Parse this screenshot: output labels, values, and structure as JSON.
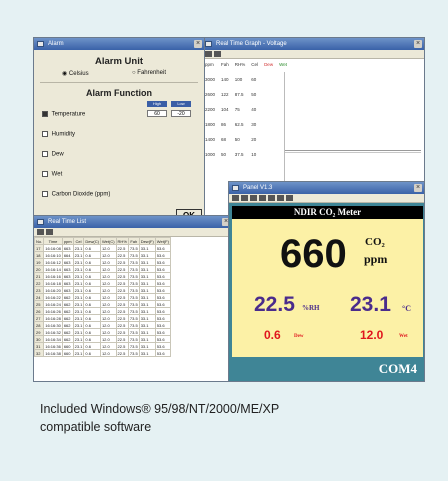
{
  "alarm_window": {
    "title": "Alarm",
    "unit_heading": "Alarm Unit",
    "unit_options": [
      "Celsius",
      "Fahrenheit"
    ],
    "function_heading": "Alarm Function",
    "high_label": "High",
    "low_label": "Low",
    "high_value": "60",
    "low_value": "-20",
    "functions": [
      "Temperature",
      "Humidity",
      "Dew",
      "Wet",
      "Carbon Dioxide (ppm)"
    ],
    "ok_label": "OK"
  },
  "graph_window": {
    "title": "Real Time Graph - Voltage",
    "columns": [
      "ppm",
      "Fah",
      "RH%",
      "Cel",
      "Dew",
      "Wet"
    ],
    "rows": [
      [
        "3000",
        "140",
        "100",
        "60"
      ],
      [
        "2600",
        "122",
        "87.5",
        "50"
      ],
      [
        "2200",
        "104",
        "75",
        "40"
      ],
      [
        "1800",
        "86",
        "62.5",
        "30"
      ],
      [
        "1400",
        "68",
        "50",
        "20"
      ],
      [
        "1000",
        "50",
        "37.5",
        "10"
      ]
    ],
    "dew_color": "#d03030",
    "wet_color": "#2a8a2a"
  },
  "list_window": {
    "title": "Real Time List",
    "headers": [
      "No.",
      "Time",
      "ppm",
      "Cel",
      "Dew(C)",
      "Wet(C)",
      "RH%",
      "Fah",
      "Dew(F)",
      "Wet(F)"
    ],
    "rows": [
      [
        "17",
        "16:16:08",
        "663",
        "23.1",
        "0.6",
        "12.0",
        "22.5",
        "73.5",
        "33.1",
        "53.6"
      ],
      [
        "18",
        "16:16:10",
        "664",
        "23.1",
        "0.6",
        "12.0",
        "22.5",
        "73.5",
        "33.1",
        "53.6"
      ],
      [
        "19",
        "16:16:12",
        "663",
        "23.1",
        "0.6",
        "12.0",
        "22.5",
        "73.5",
        "33.1",
        "53.6"
      ],
      [
        "20",
        "16:16:14",
        "663",
        "23.1",
        "0.6",
        "12.0",
        "22.5",
        "73.5",
        "33.1",
        "53.6"
      ],
      [
        "21",
        "16:16:16",
        "663",
        "23.1",
        "0.6",
        "12.0",
        "22.5",
        "73.5",
        "33.1",
        "53.6"
      ],
      [
        "22",
        "16:16:18",
        "663",
        "23.1",
        "0.6",
        "12.0",
        "22.5",
        "73.5",
        "33.1",
        "53.6"
      ],
      [
        "23",
        "16:16:20",
        "663",
        "23.1",
        "0.6",
        "12.0",
        "22.5",
        "73.5",
        "33.1",
        "53.6"
      ],
      [
        "24",
        "16:16:22",
        "662",
        "23.1",
        "0.6",
        "12.0",
        "22.5",
        "73.5",
        "33.1",
        "53.6"
      ],
      [
        "25",
        "16:16:24",
        "662",
        "23.1",
        "0.6",
        "12.0",
        "22.5",
        "73.5",
        "33.1",
        "53.6"
      ],
      [
        "26",
        "16:16:26",
        "662",
        "23.1",
        "0.6",
        "12.0",
        "22.5",
        "73.5",
        "33.1",
        "53.6"
      ],
      [
        "27",
        "16:16:28",
        "662",
        "23.1",
        "0.6",
        "12.0",
        "22.5",
        "73.5",
        "33.1",
        "53.6"
      ],
      [
        "28",
        "16:16:30",
        "662",
        "23.1",
        "0.6",
        "12.0",
        "22.5",
        "73.5",
        "33.1",
        "53.6"
      ],
      [
        "29",
        "16:16:32",
        "662",
        "23.1",
        "0.6",
        "12.0",
        "22.5",
        "73.5",
        "33.1",
        "53.6"
      ],
      [
        "30",
        "16:16:34",
        "662",
        "23.1",
        "0.6",
        "12.0",
        "22.5",
        "73.5",
        "33.1",
        "53.6"
      ],
      [
        "31",
        "16:16:36",
        "660",
        "23.1",
        "0.6",
        "12.0",
        "22.5",
        "73.5",
        "33.1",
        "53.6"
      ],
      [
        "32",
        "16:16:38",
        "660",
        "23.1",
        "0.6",
        "12.0",
        "22.5",
        "73.5",
        "33.1",
        "53.6"
      ]
    ]
  },
  "panel_window": {
    "title": "Panel  V1.3",
    "header": "NDIR CO₂ Meter",
    "co2_value": "660",
    "co2_unit_top": "CO₂",
    "co2_unit_bottom": "ppm",
    "rh_value": "22.5",
    "rh_unit": "%RH",
    "temp_value": "23.1",
    "temp_unit": "°C",
    "dew_value": "0.6",
    "dew_label": "Dew",
    "wet_value": "12.0",
    "wet_label": "Wet",
    "port": "COM4",
    "meter_color": "#fcf1a6",
    "purple_color": "#4a2c8c",
    "red_color": "#e0161e"
  },
  "caption": {
    "line1": "Included Windows® 95/98/NT/2000/ME/XP",
    "line2": "compatible software"
  }
}
